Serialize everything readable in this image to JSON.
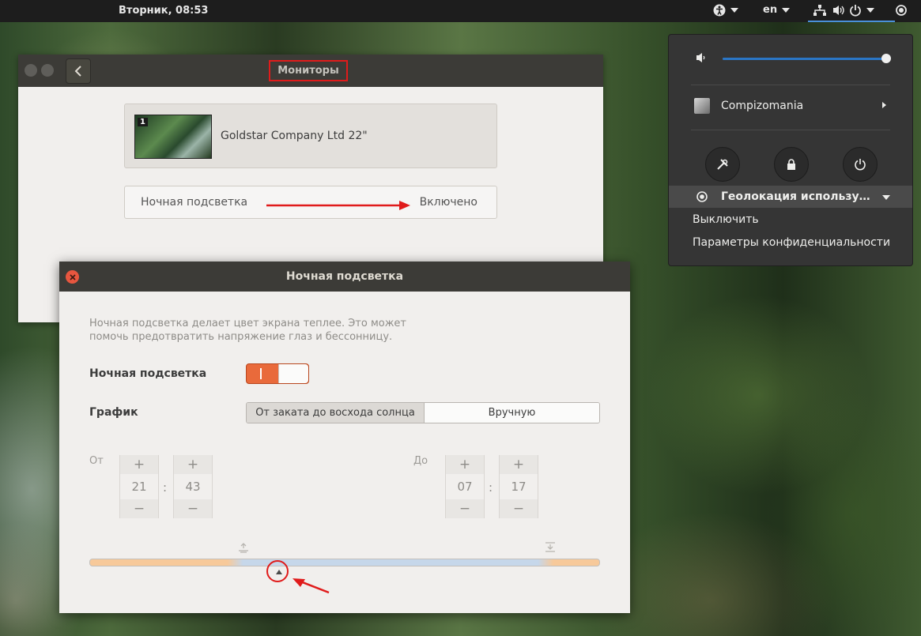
{
  "topbar": {
    "clock": "Вторник, 08:53",
    "keyboard_layout": "en",
    "icons": [
      "accessibility-icon",
      "network-icon",
      "volume-icon",
      "power-icon",
      "location-icon"
    ]
  },
  "monitors_window": {
    "title": "Мониторы",
    "monitor": {
      "number": "1",
      "name": "Goldstar Company Ltd 22\""
    },
    "night_light_row": {
      "label": "Ночная подсветка",
      "value": "Включено"
    }
  },
  "night_light_dialog": {
    "title": "Ночная подсветка",
    "description": "Ночная подсветка делает цвет экрана теплее. Это может помочь предотвратить напряжение глаз и бессонницу.",
    "toggle_label": "Ночная подсветка",
    "toggle_state": "on",
    "schedule_label": "График",
    "schedule_options": [
      "От заката до восхода солнца",
      "Вручную"
    ],
    "schedule_selected": "От заката до восхода солнца",
    "from_label": "От",
    "to_label": "До",
    "from_time": {
      "hours": "21",
      "minutes": "43"
    },
    "to_time": {
      "hours": "07",
      "minutes": "17"
    },
    "plus": "+",
    "minus": "−",
    "colon": ":"
  },
  "system_menu": {
    "volume_level": 1.0,
    "user_name": "Compizomania",
    "geolocation_label": "Геолокация используется",
    "geolocation_items": [
      "Выключить",
      "Параметры конфиденциальности"
    ]
  },
  "colors": {
    "accent_orange": "#e96a3b",
    "annotation_red": "#e01b1b",
    "volume_blue": "#2a76c6",
    "header_dark": "#3c3b37"
  }
}
